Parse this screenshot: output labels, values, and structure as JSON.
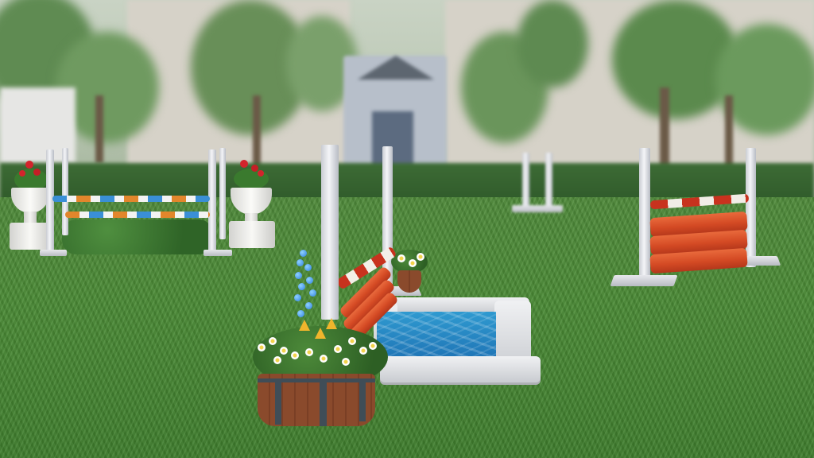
{
  "scene": {
    "kind": "equestrian-jump-course",
    "ui_text": []
  },
  "colors": {
    "grass": "#4a8a35",
    "water": "#2f9ad0",
    "plank_orange": "#d44a24",
    "pole_blue": "#3a8fd6",
    "pole_orange": "#e2862c",
    "post_white": "#eef0f4",
    "geranium_red": "#d3242c"
  },
  "objects": {
    "left_jump": {
      "label": ""
    },
    "plank_jump": {
      "label": ""
    },
    "water_jump": {
      "label": ""
    },
    "flower_barrel": {
      "label": ""
    },
    "distant_jump": {
      "label": ""
    }
  }
}
